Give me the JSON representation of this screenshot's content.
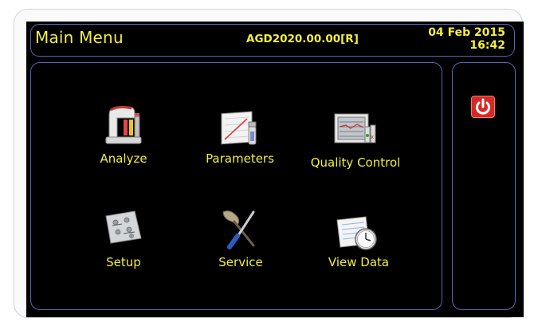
{
  "header": {
    "title": "Main Menu",
    "system_id": "AGD2020.00.00[R]",
    "date": "04 Feb 2015",
    "time": "16:42"
  },
  "menu": {
    "analyze": {
      "label": "Analyze",
      "icon": "analyzer-icon"
    },
    "parameters": {
      "label": "Parameters",
      "icon": "parameters-chart-icon"
    },
    "quality_control": {
      "label": "Quality Control",
      "icon": "quality-control-icon"
    },
    "setup": {
      "label": "Setup",
      "icon": "setup-panel-icon"
    },
    "service": {
      "label": "Service",
      "icon": "service-tools-icon"
    },
    "view_data": {
      "label": "View Data",
      "icon": "view-data-clock-icon"
    }
  },
  "side": {
    "power_icon": "power-icon"
  },
  "colors": {
    "text": "#f3ee43",
    "border": "#5866b8",
    "background": "#000000",
    "power": "#d42a25"
  }
}
